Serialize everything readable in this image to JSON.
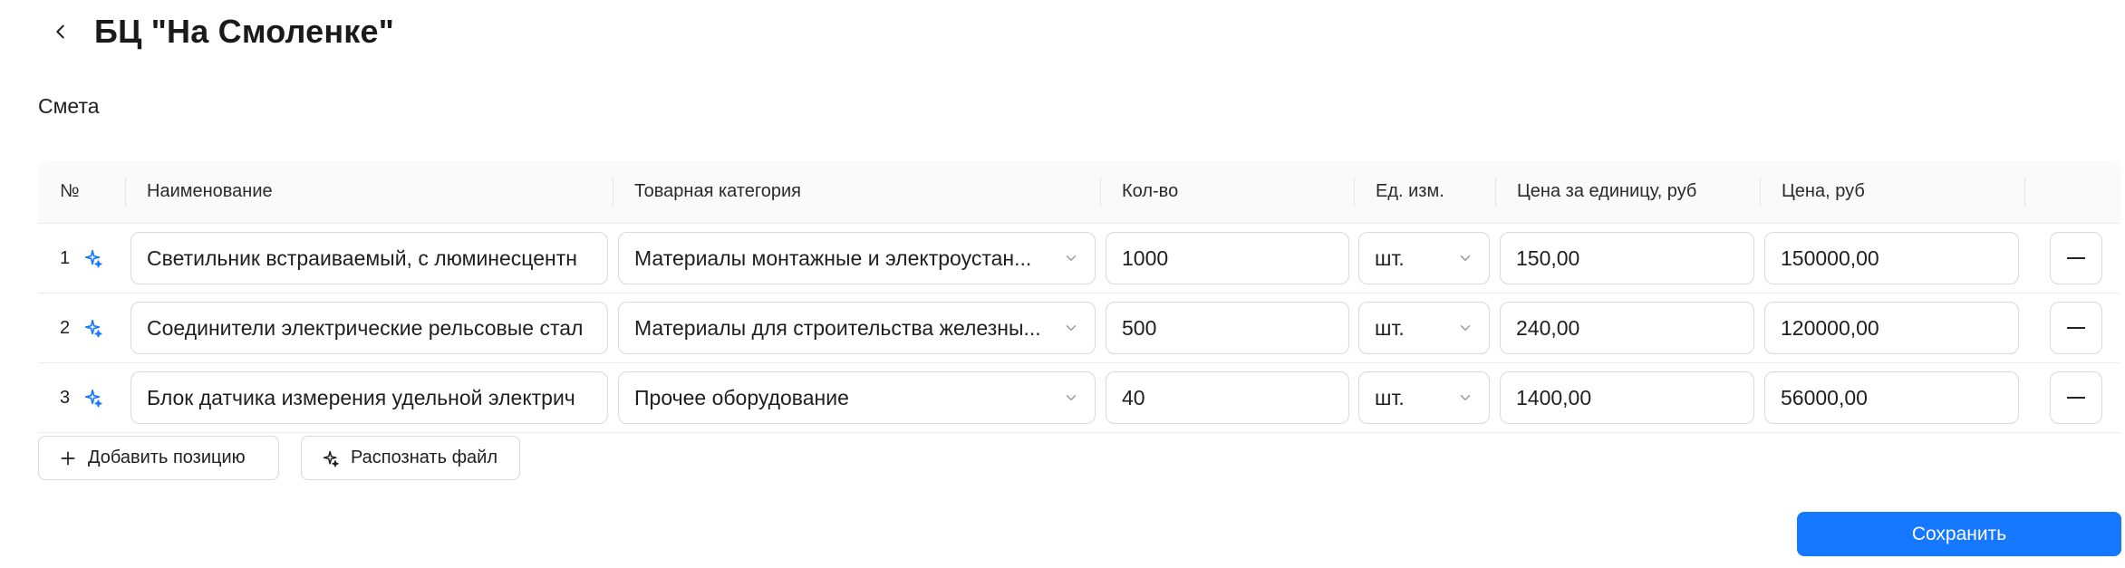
{
  "header": {
    "title": "БЦ \"На Смоленке\"",
    "back_icon": "chevron-left-icon"
  },
  "section": {
    "label": "Смета"
  },
  "table": {
    "columns": [
      "№",
      "Наименование",
      "Товарная категория",
      "Кол-во",
      "Ед. изм.",
      "Цена за единицу, руб",
      "Цена, руб"
    ],
    "rows": [
      {
        "num": "1",
        "name": "Светильник встраиваемый, с люминесцентн",
        "category": "Материалы монтажные и электроустан...",
        "qty": "1000",
        "unit": "шт.",
        "price_unit": "150,00",
        "price_total": "150000,00"
      },
      {
        "num": "2",
        "name": "Соединители электрические рельсовые стал",
        "category": "Материалы для строительства железны...",
        "qty": "500",
        "unit": "шт.",
        "price_unit": "240,00",
        "price_total": "120000,00"
      },
      {
        "num": "3",
        "name": "Блок датчика измерения удельной электрич",
        "category": "Прочее оборудование",
        "qty": "40",
        "unit": "шт.",
        "price_unit": "1400,00",
        "price_total": "56000,00"
      }
    ]
  },
  "actions": {
    "add_label": "Добавить позицию",
    "recognize_label": "Распознать файл"
  },
  "footer": {
    "save_label": "Сохранить"
  },
  "colors": {
    "accent": "#1677ff",
    "border": "#d9d9d9",
    "header_bg": "#fafafa"
  }
}
